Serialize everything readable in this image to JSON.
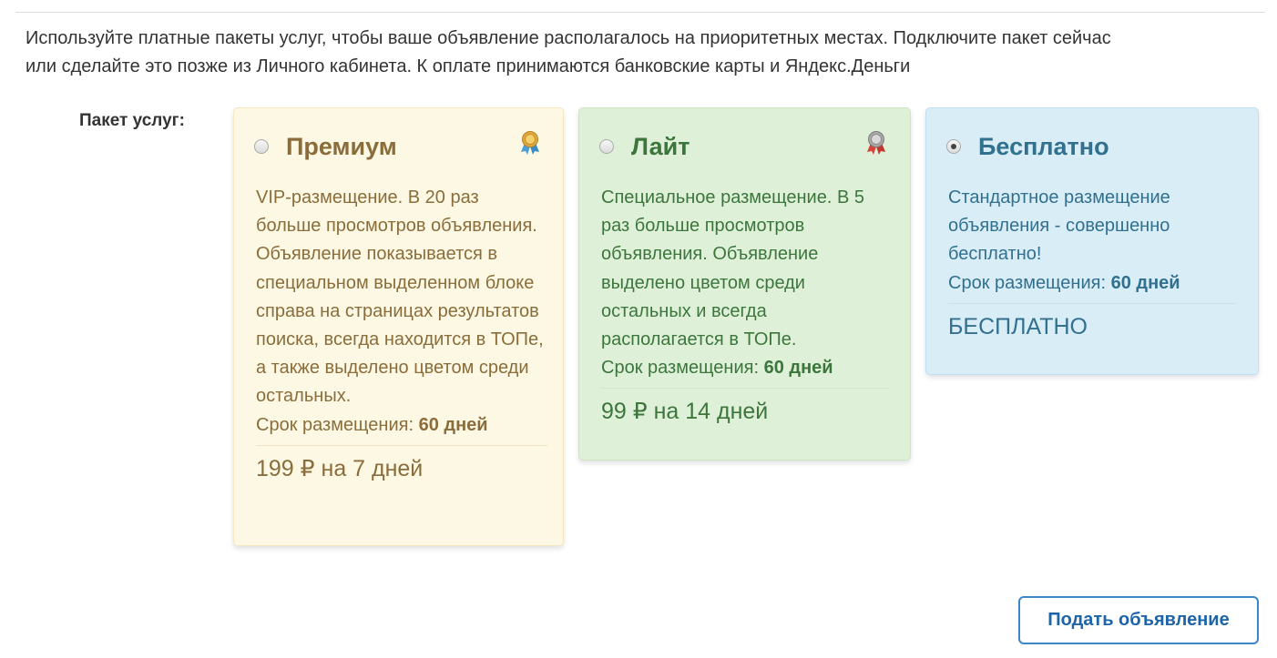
{
  "intro": {
    "line1": "Используйте платные пакеты услуг, чтобы ваше объявление располагалось на приоритетных местах. Подключите пакет сейчас",
    "line2": "или сделайте это позже из Личного кабинета. К оплате принимаются банковские карты и Яндекс.Деньги"
  },
  "package_label": "Пакет услуг:",
  "packages": [
    {
      "title": "Премиум",
      "selected": false,
      "icon": "award-ribbon-gold-icon",
      "description": "VIP-размещение. В 20 раз больше просмотров объявления. Объявление показывается в специальном выделенном блоке справа на страницах результатов поиска, всегда находится в ТОПе, а также выделено цветом среди остальных.",
      "term_label": "Срок размещения:",
      "term_value": "60 дней",
      "price": "199 ₽ на 7 дней",
      "colors": {
        "background": "#fcf8e3",
        "text": "#8a6d3b"
      }
    },
    {
      "title": "Лайт",
      "selected": false,
      "icon": "award-ribbon-silver-icon",
      "description": "Специальное размещение. В 5 раз больше просмотров объявления. Объявление выделено цветом среди остальных и всегда располагается в ТОПе.",
      "term_label": "Срок размещения:",
      "term_value": "60 дней",
      "price": "99 ₽ на 14 дней",
      "colors": {
        "background": "#dff0d8",
        "text": "#3c763d"
      }
    },
    {
      "title": "Бесплатно",
      "selected": true,
      "description": "Стандартное размещение объявления - совершенно бесплатно!",
      "term_label": "Срок размещения:",
      "term_value": "60 дней",
      "price": "БЕСПЛАТНО",
      "colors": {
        "background": "#d9edf7",
        "text": "#31708f"
      }
    }
  ],
  "submit_label": "Подать объявление"
}
